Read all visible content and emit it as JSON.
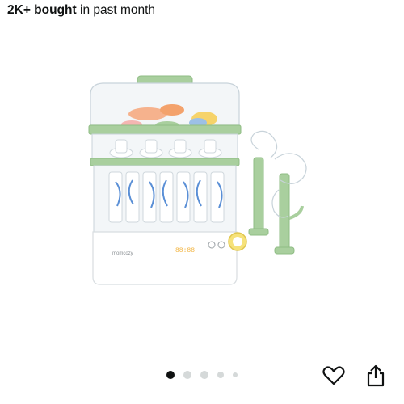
{
  "header": {
    "bought_bold": "2K+ bought",
    "bought_rest": " in past month"
  },
  "product": {
    "image_icon": "baby-bottle-sterilizer-product-photo",
    "logo_text": "momcozy",
    "display_text": "88:88"
  },
  "carousel": {
    "total": 5,
    "active_index": 0
  },
  "actions": {
    "favorite_icon": "heart-icon",
    "share_icon": "share-icon"
  },
  "colors": {
    "accent_green": "#a9cf9e",
    "active_dot": "#0f1111",
    "inactive_dot": "#d5d9d9"
  }
}
